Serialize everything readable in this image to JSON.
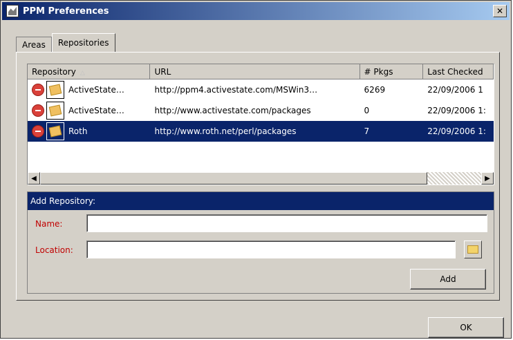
{
  "window": {
    "title": "PPM Preferences",
    "close_glyph": "✕"
  },
  "tabs": [
    {
      "label": "Areas",
      "active": false
    },
    {
      "label": "Repositories",
      "active": true
    }
  ],
  "repositories": {
    "columns": [
      "Repository",
      "URL",
      "# Pkgs",
      "Last Checked"
    ],
    "sort_glyph": "△",
    "rows": [
      {
        "name": "ActiveState…",
        "url": "http://ppm4.activestate.com/MSWin3…",
        "pkgs": "6269",
        "last_checked": "22/09/2006 1",
        "selected": false
      },
      {
        "name": "ActiveState…",
        "url": "http://www.activestate.com/packages",
        "pkgs": "0",
        "last_checked": "22/09/2006 1:",
        "selected": false
      },
      {
        "name": "Roth",
        "url": "http://www.roth.net/perl/packages",
        "pkgs": "7",
        "last_checked": "22/09/2006 1:",
        "selected": true
      }
    ],
    "scroll_left_glyph": "◀",
    "scroll_right_glyph": "▶"
  },
  "add_repository": {
    "header": "Add Repository:",
    "name_label": "Name:",
    "name_value": "",
    "location_label": "Location:",
    "location_value": "",
    "add_label": "Add"
  },
  "footer": {
    "ok_label": "OK"
  },
  "icons": {
    "remove": "remove-icon",
    "package": "package-icon",
    "folder": "folder-icon",
    "app": "ppm-app-icon"
  },
  "colors": {
    "titlebar": "#0a246a",
    "selection": "#0a246a",
    "required_label": "#c00000"
  }
}
